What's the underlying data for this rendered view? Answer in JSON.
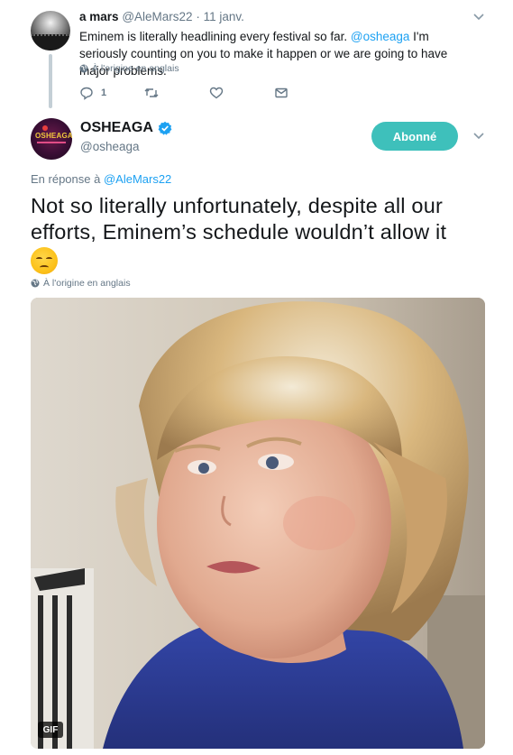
{
  "parent_tweet": {
    "display_name": "a mars",
    "handle": "@AleMars22",
    "separator": "·",
    "date": "11 janv.",
    "text_before": "Eminem is literally headlining every festival so far. ",
    "mention": "@osheaga",
    "text_after": " I'm seriously counting on you to make it happen or we are going to have major problems.",
    "translation_note": "À l'origine en anglais",
    "reply_count": "1",
    "icons": [
      "reply-icon",
      "retweet-icon",
      "like-icon",
      "message-icon",
      "chevron-down-icon"
    ]
  },
  "main_tweet": {
    "display_name": "OSHEAGA",
    "handle": "@osheaga",
    "follow_label": "Abonné",
    "reply_prefix": "En réponse à ",
    "reply_to": "@AleMars22",
    "text": "Not so literally unfortunately, despite all our efforts, Eminem’s schedule wouldn’t allow it",
    "emoji": "disappointed-face",
    "translation_note": "À l'origine en anglais",
    "media_badge": "GIF",
    "colors": {
      "follow_button": "#3ec0bb",
      "mention": "#1da1f2",
      "verified": "#1da1f2",
      "secondary_text": "#657786"
    }
  }
}
